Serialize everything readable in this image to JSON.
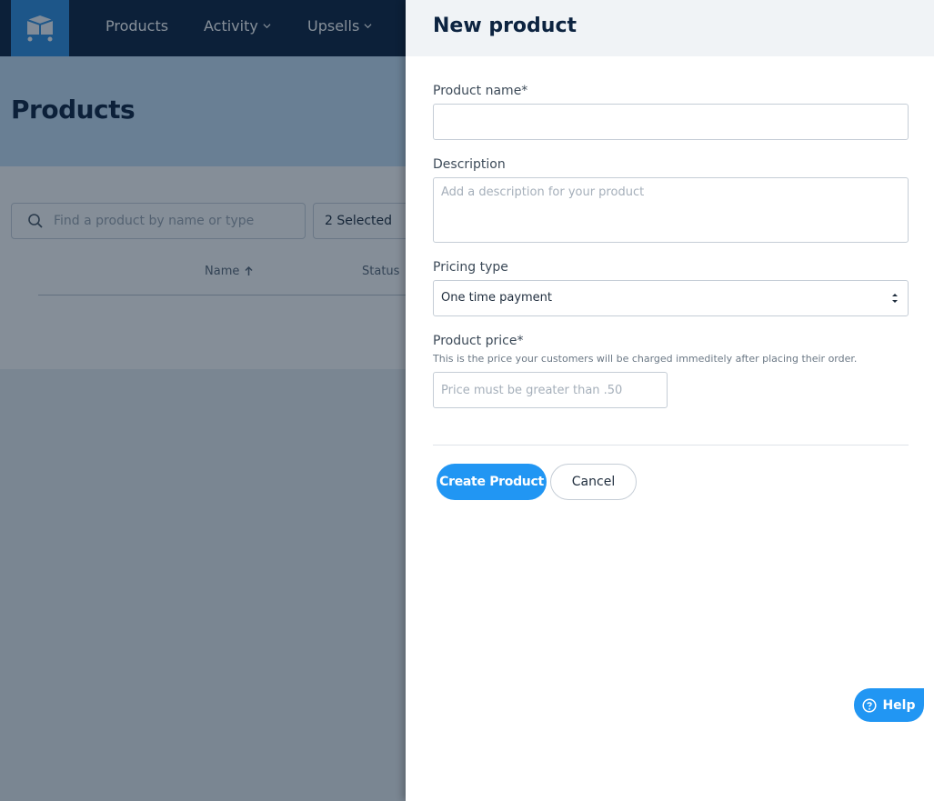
{
  "nav": {
    "logo_icon": "cart-box-icon",
    "items": [
      {
        "label": "Products"
      },
      {
        "label": "Activity"
      },
      {
        "label": "Upsells"
      }
    ]
  },
  "page": {
    "title": "Products",
    "search_placeholder": "Find a product by name or type",
    "selected_filter": "2 Selected",
    "columns": [
      {
        "label": "Name",
        "sort": "ascending"
      },
      {
        "label": "Status"
      }
    ]
  },
  "drawer": {
    "title": "New product",
    "product_name_label": "Product name*",
    "product_name_value": "",
    "description_label": "Description",
    "description_placeholder": "Add a description for your product",
    "pricing_type_label": "Pricing type",
    "pricing_type_value": "One time payment",
    "price_label": "Product price*",
    "price_help": "This is the price your customers will be charged immeditely after placing their order.",
    "price_placeholder": "Price must be greater than .50",
    "create_label": "Create Product",
    "cancel_label": "Cancel"
  },
  "help": {
    "label": "Help"
  },
  "colors": {
    "nav_bg": "#0c2340",
    "accent": "#2196f3",
    "page_band": "#c7e1f7"
  }
}
